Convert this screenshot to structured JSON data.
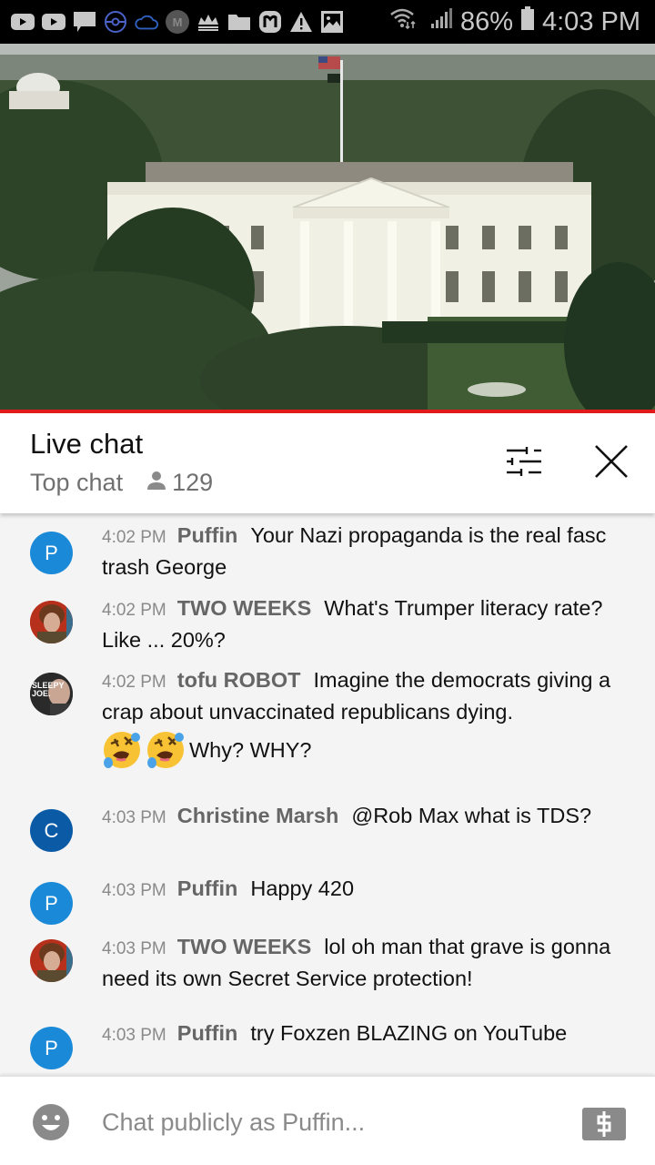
{
  "status_bar": {
    "notification_icons": [
      "youtube-icon",
      "youtube-icon",
      "message-icon",
      "pokeball-icon",
      "cloud-icon",
      "m-app-icon",
      "crown-icon",
      "folder-icon",
      "mastodon-icon",
      "warning-icon",
      "image-icon"
    ],
    "battery": "86%",
    "time": "4:03 PM"
  },
  "video": {
    "progress_fraction": 1.0,
    "progress_color": "#e21a1a"
  },
  "chat_header": {
    "title": "Live chat",
    "mode": "Top chat",
    "viewer_count": "129"
  },
  "messages": [
    {
      "time": "4:02 PM",
      "author": "Puffin",
      "text": "Your Nazi propaganda is the real fasc trash George",
      "avatar": {
        "type": "letter",
        "letter": "P",
        "color": "#1a8ad8"
      }
    },
    {
      "time": "4:02 PM",
      "author": "TWO WEEKS",
      "text": "What's Trumper literacy rate? Like ... 20%?",
      "avatar": {
        "type": "photo"
      }
    },
    {
      "time": "4:02 PM",
      "author": "tofu ROBOT",
      "text": "Imagine the democrats giving a crap about unvaccinated republicans dying.",
      "extra_text": "Why? WHY?",
      "emojis": [
        "rofl-emoji",
        "rofl-emoji"
      ],
      "avatar": {
        "type": "photo",
        "caption": "SLEEPY JOE."
      }
    },
    {
      "time": "4:03 PM",
      "author": "Christine Marsh",
      "text": "@Rob Max what is TDS?",
      "avatar": {
        "type": "letter",
        "letter": "C",
        "color": "#0b5aa5"
      }
    },
    {
      "time": "4:03 PM",
      "author": "Puffin",
      "text": "Happy 420",
      "avatar": {
        "type": "letter",
        "letter": "P",
        "color": "#1a8ad8"
      }
    },
    {
      "time": "4:03 PM",
      "author": "TWO WEEKS",
      "text": "lol oh man that grave is gonna need its own Secret Service protection!",
      "avatar": {
        "type": "photo"
      }
    },
    {
      "time": "4:03 PM",
      "author": "Puffin",
      "text": "try Foxzen BLAZING on YouTube",
      "avatar": {
        "type": "letter",
        "letter": "P",
        "color": "#1a8ad8"
      }
    }
  ],
  "input": {
    "placeholder": "Chat publicly as Puffin..."
  }
}
